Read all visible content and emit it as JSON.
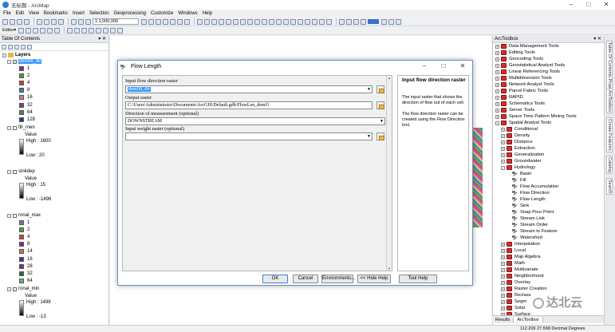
{
  "app": {
    "title": "无标题 - ArcMap"
  },
  "menu": [
    "File",
    "Edit",
    "View",
    "Bookmarks",
    "Insert",
    "Selection",
    "Geoprocessing",
    "Customize",
    "Windows",
    "Help"
  ],
  "toolbar": {
    "scale": "1:1,000,000",
    "editor": "Editor▾"
  },
  "toc": {
    "title": "Table Of Contents",
    "layers_label": "Layers",
    "demfill": {
      "name": "demfill_dir",
      "classes": [
        {
          "label": "1",
          "color": "#7b2d8f"
        },
        {
          "label": "2",
          "color": "#3aa63a"
        },
        {
          "label": "4",
          "color": "#d43d3d"
        },
        {
          "label": "8",
          "color": "#3a78c8"
        },
        {
          "label": "16",
          "color": "#d08080"
        },
        {
          "label": "32",
          "color": "#8a3a8a"
        },
        {
          "label": "64",
          "color": "#4a8a3a"
        },
        {
          "label": "128",
          "color": "#2a3a9a"
        }
      ]
    },
    "fill_men": {
      "name": "fill_men",
      "value": "Value",
      "high": "High : 1600",
      "low": "Low : 20"
    },
    "sinkdep": {
      "name": "sinkdep",
      "value": "Value",
      "high": "High : 15",
      "low": "Low : -1496"
    },
    "ronal_max": {
      "name": "ronal_max",
      "classes": [
        {
          "label": "1",
          "color": "#5a7ab8"
        },
        {
          "label": "2",
          "color": "#3aa63a"
        },
        {
          "label": "4",
          "color": "#d43d3d"
        },
        {
          "label": "8",
          "color": "#7b2d8f"
        },
        {
          "label": "14",
          "color": "#c87a3a"
        },
        {
          "label": "16",
          "color": "#3a3a9a"
        },
        {
          "label": "28",
          "color": "#8a2a6a"
        },
        {
          "label": "32",
          "color": "#2a6a3a"
        },
        {
          "label": "64",
          "color": "#6ab86a"
        }
      ]
    },
    "ronal_min": {
      "name": "ronal_min",
      "value": "Value",
      "high": "High : 1498",
      "low": "Low : -13"
    }
  },
  "dialog": {
    "title": "Flow Length",
    "params": [
      {
        "label": "Input flow direction raster",
        "value": "demfill_dir"
      },
      {
        "label": "Output raster",
        "value": "C:\\Users\\Administrator\\Documents\\ArcGIS\\Default.gdb\\FlowLen_demf1"
      },
      {
        "label": "Direction of measurement (optional)",
        "value": "DOWNSTREAM"
      },
      {
        "label": "Input weight raster (optional)",
        "value": ""
      }
    ],
    "help_title": "Input flow direction raster",
    "help_p1": "The input raster that shows the direction of flow out of each cell.",
    "help_p2": "The flow direction raster can be created using the Flow Direction tool.",
    "buttons": {
      "ok": "OK",
      "cancel": "Cancel",
      "env": "Environments...",
      "hide": "<< Hide Help",
      "toolhelp": "Tool Help"
    }
  },
  "arctoolbox": {
    "title": "ArcToolbox",
    "toolboxes": [
      "Data Management Tools",
      "Editing Tools",
      "Geocoding Tools",
      "Geostatistical Analyst Tools",
      "Linear Referencing Tools",
      "Multidimension Tools",
      "Network Analyst Tools",
      "Parcel Fabric Tools",
      "RAPID",
      "Schematics Tools",
      "Server Tools",
      "Space Time Pattern Mining Tools",
      "Spatial Analyst Tools"
    ],
    "spatial_sub": [
      "Conditional",
      "Density",
      "Distance",
      "Extraction",
      "Generalization",
      "Groundwater",
      "Hydrology"
    ],
    "hydrology_tools": [
      "Basin",
      "Fill",
      "Flow Accumulation",
      "Flow Direction",
      "Flow Length",
      "Sink",
      "Snap Pour Point",
      "Stream Link",
      "Stream Order",
      "Stream to Feature",
      "Watershed"
    ],
    "spatial_sub2": [
      "Interpolation",
      "Local",
      "Map Algebra",
      "Math",
      "Multivariate",
      "Neighborhood",
      "Overlay",
      "Raster Creation",
      "Reclass",
      "Segm",
      "Solar",
      "Surface"
    ],
    "tabs": [
      "Results",
      "ArcToolbox"
    ]
  },
  "side_tabs": [
    "Table Of Contents Properties",
    "ArcToolbox",
    "Create Features",
    "Catalog",
    "Search"
  ],
  "status": {
    "coords": "112.209  27.568 Decimal Degrees"
  },
  "watermark": "达北云"
}
